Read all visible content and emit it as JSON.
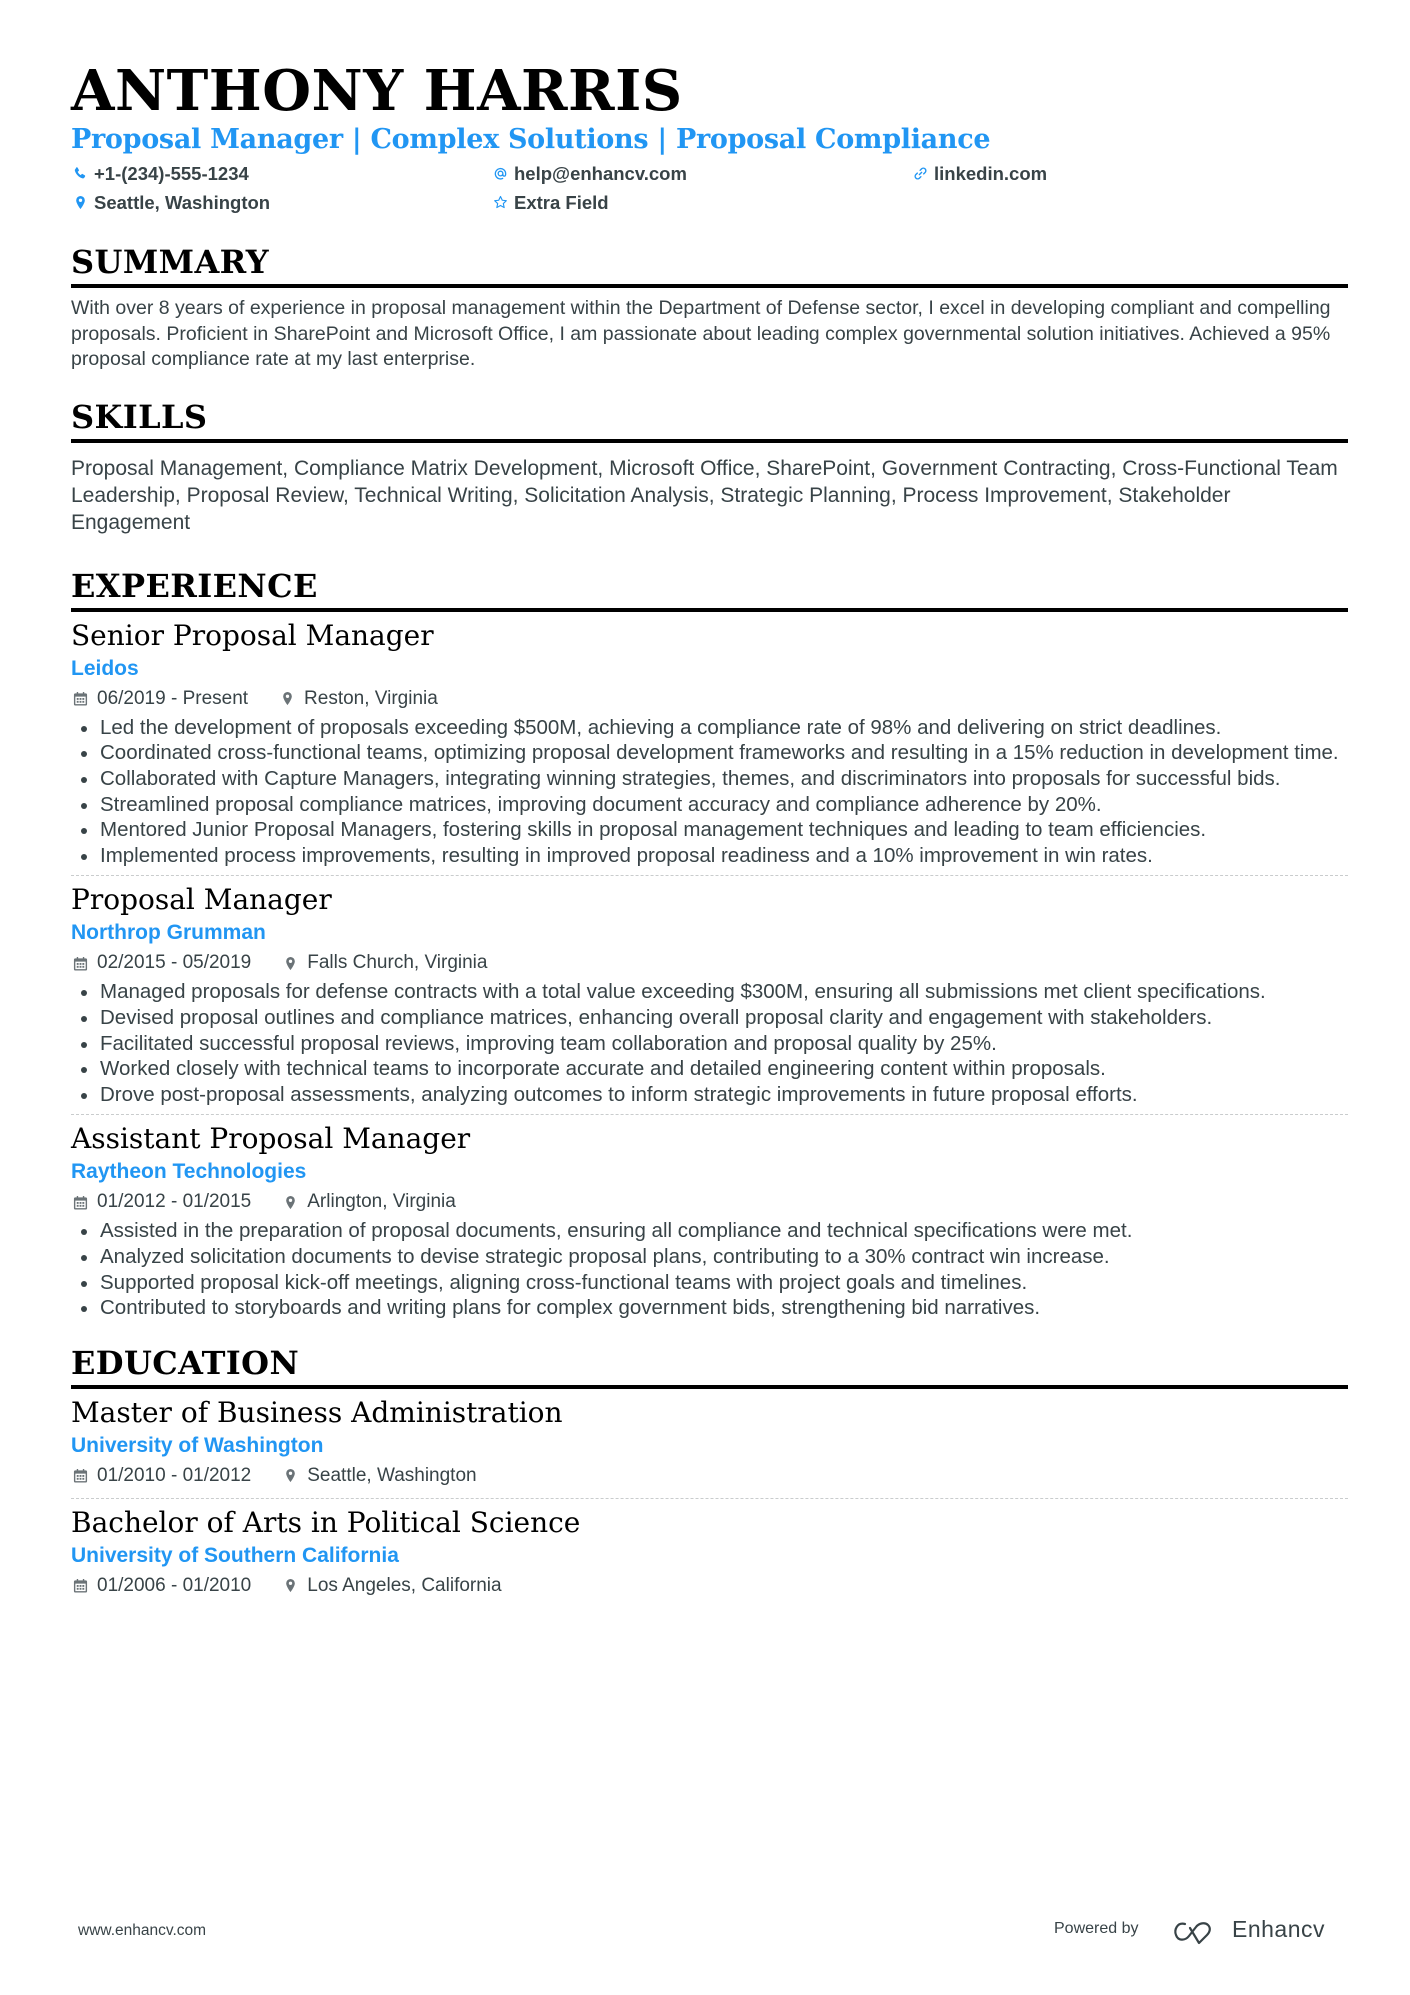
{
  "header": {
    "name": "ANTHONY HARRIS",
    "subtitle": "Proposal Manager | Complex Solutions | Proposal Compliance",
    "accent_color": "#2196f3",
    "contacts": [
      {
        "icon": "phone-icon",
        "text": "+1-(234)-555-1234"
      },
      {
        "icon": "at-icon",
        "text": "help@enhancv.com"
      },
      {
        "icon": "link-icon",
        "text": "linkedin.com"
      },
      {
        "icon": "location-pin-icon",
        "text": "Seattle, Washington"
      },
      {
        "icon": "star-icon",
        "text": "Extra Field"
      }
    ]
  },
  "summary": {
    "title": "SUMMARY",
    "text": "With over 8 years of experience in proposal management within the Department of Defense sector, I excel in developing compliant and compelling proposals. Proficient in SharePoint and Microsoft Office, I am passionate about leading complex governmental solution initiatives. Achieved a 95% proposal compliance rate at my last enterprise."
  },
  "skills": {
    "title": "SKILLS",
    "text": "Proposal Management, Compliance Matrix Development, Microsoft Office, SharePoint, Government Contracting, Cross-Functional Team Leadership, Proposal Review, Technical Writing, Solicitation Analysis, Strategic Planning, Process Improvement, Stakeholder Engagement"
  },
  "experience": {
    "title": "EXPERIENCE",
    "jobs": [
      {
        "title": "Senior Proposal Manager",
        "company": "Leidos",
        "dates": "06/2019 - Present",
        "location": "Reston, Virginia",
        "bullets": [
          "Led the development of proposals exceeding $500M, achieving a compliance rate of 98% and delivering on strict deadlines.",
          "Coordinated cross-functional teams, optimizing proposal development frameworks and resulting in a 15% reduction in development time.",
          "Collaborated with Capture Managers, integrating winning strategies, themes, and discriminators into proposals for successful bids.",
          "Streamlined proposal compliance matrices, improving document accuracy and compliance adherence by 20%.",
          "Mentored Junior Proposal Managers, fostering skills in proposal management techniques and leading to team efficiencies.",
          "Implemented process improvements, resulting in improved proposal readiness and a 10% improvement in win rates."
        ]
      },
      {
        "title": "Proposal Manager",
        "company": "Northrop Grumman",
        "dates": "02/2015 - 05/2019",
        "location": "Falls Church, Virginia",
        "bullets": [
          "Managed proposals for defense contracts with a total value exceeding $300M, ensuring all submissions met client specifications.",
          "Devised proposal outlines and compliance matrices, enhancing overall proposal clarity and engagement with stakeholders.",
          "Facilitated successful proposal reviews, improving team collaboration and proposal quality by 25%.",
          "Worked closely with technical teams to incorporate accurate and detailed engineering content within proposals.",
          "Drove post-proposal assessments, analyzing outcomes to inform strategic improvements in future proposal efforts."
        ]
      },
      {
        "title": "Assistant Proposal Manager",
        "company": "Raytheon Technologies",
        "dates": "01/2012 - 01/2015",
        "location": "Arlington, Virginia",
        "bullets": [
          "Assisted in the preparation of proposal documents, ensuring all compliance and technical specifications were met.",
          "Analyzed solicitation documents to devise strategic proposal plans, contributing to a 30% contract win increase.",
          "Supported proposal kick-off meetings, aligning cross-functional teams with project goals and timelines.",
          "Contributed to storyboards and writing plans for complex government bids, strengthening bid narratives."
        ]
      }
    ]
  },
  "education": {
    "title": "EDUCATION",
    "items": [
      {
        "degree": "Master of Business Administration",
        "school": "University of Washington",
        "dates": "01/2010 - 01/2012",
        "location": "Seattle, Washington"
      },
      {
        "degree": "Bachelor of Arts in Political Science",
        "school": "University of Southern California",
        "dates": "01/2006 - 01/2010",
        "location": "Los Angeles, California"
      }
    ]
  },
  "footer": {
    "url": "www.enhancv.com",
    "powered_by": "Powered by",
    "brand": "Enhancv"
  }
}
